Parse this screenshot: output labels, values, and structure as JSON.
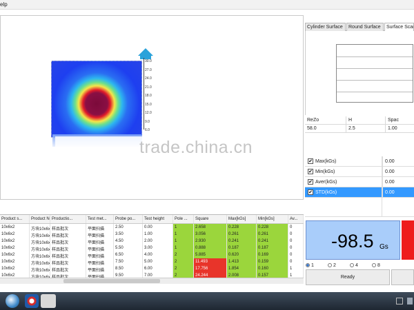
{
  "menubar": {
    "help_label": "elp"
  },
  "scale": {
    "ticks": [
      "30.0",
      "27.0",
      "24.0",
      "21.0",
      "18.0",
      "15.0",
      "12.0",
      "9.0",
      "6.0"
    ]
  },
  "watermark": "trade.china.cn",
  "tabs": [
    {
      "label": "Cylinder Surface"
    },
    {
      "label": "Round Surface"
    },
    {
      "label": "Surface Scan"
    }
  ],
  "rezo_table": {
    "headers": [
      "ReZo",
      "H",
      "Spac"
    ],
    "row": [
      "58.0",
      "2.5",
      "1.00"
    ]
  },
  "stats": [
    {
      "label": "Max(kGs)",
      "value": "0.00",
      "checked": "✔"
    },
    {
      "label": "Min(kGs)",
      "value": "0.00",
      "checked": "✔"
    },
    {
      "label": "Aver(kGs)",
      "value": "0.00",
      "checked": "✔"
    },
    {
      "label": "STD(kGs)",
      "value": "0.00",
      "checked": "✔"
    }
  ],
  "data_table": {
    "headers": [
      "Product s...",
      "Product No",
      "Productio...",
      "Test met...",
      "Probe po...",
      "Test height",
      "Pole ...",
      "Square",
      "Max[kGs]",
      "Min[kGs]",
      "Av..."
    ],
    "rows": [
      [
        "10x6x2",
        "方块10x6x2",
        "样品批次",
        "平面扫描",
        "2.50",
        "0.00",
        "1",
        "2.658",
        "0.228",
        "0.228",
        "0"
      ],
      [
        "10x6x2",
        "方块10x6x2",
        "样品批次",
        "平面扫描",
        "3.50",
        "1.00",
        "1",
        "3.056",
        "0.261",
        "0.261",
        "0"
      ],
      [
        "10x6x2",
        "方块10x6x2",
        "样品批次",
        "平面扫描",
        "4.50",
        "2.00",
        "1",
        "2.930",
        "0.241",
        "0.241",
        "0"
      ],
      [
        "10x6x2",
        "方块10x6x2",
        "样品批次",
        "平面扫描",
        "5.50",
        "3.00",
        "1",
        "0.888",
        "0.187",
        "0.187",
        "0"
      ],
      [
        "10x6x2",
        "方块10x6x2",
        "样品批次",
        "平面扫描",
        "6.50",
        "4.00",
        "2",
        "5.885",
        "0.620",
        "0.169",
        "0"
      ],
      [
        "10x6x2",
        "方块10x6x2",
        "样品批次",
        "平面扫描",
        "7.50",
        "5.00",
        "2",
        "11.493",
        "1.413",
        "0.159",
        "0"
      ],
      [
        "10x6x2",
        "方块10x6x2",
        "样品批次",
        "平面扫描",
        "8.50",
        "6.00",
        "2",
        "17.756",
        "1.854",
        "0.160",
        "1"
      ],
      [
        "10x6x2",
        "方块10x6x2",
        "样品批次",
        "平面扫描",
        "9.50",
        "7.00",
        "2",
        "24.244",
        "2.008",
        "0.157",
        "1"
      ]
    ],
    "square_colors": [
      "green",
      "green",
      "green",
      "green",
      "green",
      "red",
      "red",
      "red"
    ]
  },
  "readout": {
    "value": "-98.5",
    "unit": "Gs"
  },
  "radios": [
    {
      "label": "1",
      "checked": true
    },
    {
      "label": "2",
      "checked": false
    },
    {
      "label": "4",
      "checked": false
    },
    {
      "label": "8",
      "checked": false
    }
  ],
  "ready_button": "Ready",
  "colors": {
    "readout_bg": "#a9cdfa",
    "alert_red": "#ee1c1c",
    "cell_green": "#9bd63c",
    "cell_red": "#e8342a",
    "selection_blue": "#3399ff"
  }
}
